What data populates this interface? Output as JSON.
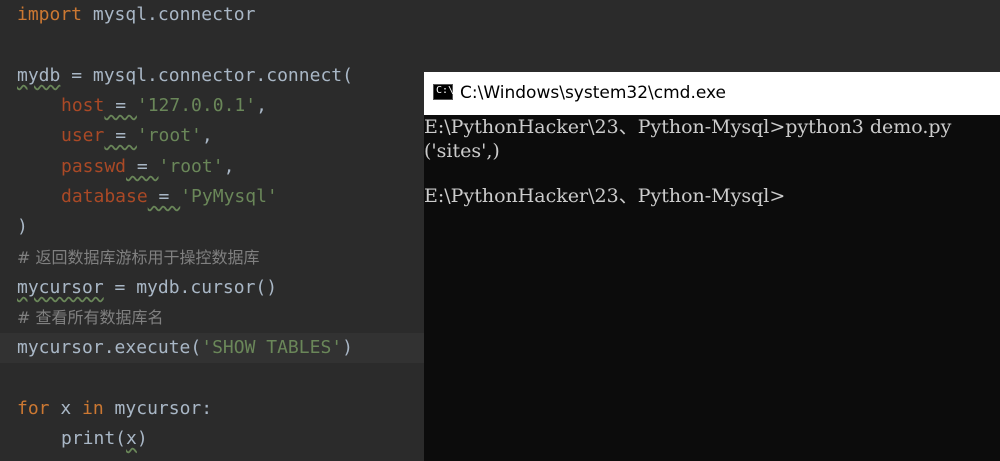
{
  "editor": {
    "line1": {
      "kw": "import",
      "rest": " mysql.connector"
    },
    "line3": {
      "var": "mydb",
      "rest": " = mysql.connector.connect("
    },
    "line4": {
      "param": "host",
      "eq": " = ",
      "str": "'127.0.0.1'",
      "comma": ","
    },
    "line5": {
      "param": "user",
      "eq": " = ",
      "str": "'root'",
      "comma": ","
    },
    "line6": {
      "param": "passwd",
      "eq": " = ",
      "str": "'root'",
      "comma": ","
    },
    "line7": {
      "param": "database",
      "eq": " = ",
      "str": "'PyMysql'"
    },
    "line8": {
      "text": ")"
    },
    "line9": {
      "comment": "# 返回数据库游标用于操控数据库"
    },
    "line10": {
      "var": "mycursor",
      "rest": " = mydb.cursor()"
    },
    "line11": {
      "comment": "# 查看所有数据库名"
    },
    "line12": {
      "pre": "mycursor.execute(",
      "str": "'SHOW TABLES'",
      "post": ")"
    },
    "line14": {
      "kw1": "for",
      "mid": " x ",
      "kw2": "in",
      "rest": " mycursor:"
    },
    "line15": {
      "pre": "print(",
      "var": "x",
      "post": ")"
    }
  },
  "cmd": {
    "title": "C:\\Windows\\system32\\cmd.exe",
    "icon_text": "C:\\",
    "lines": [
      "E:\\PythonHacker\\23、Python-Mysql>python3 demo.py",
      "('sites',)",
      "",
      "E:\\PythonHacker\\23、Python-Mysql>"
    ]
  }
}
